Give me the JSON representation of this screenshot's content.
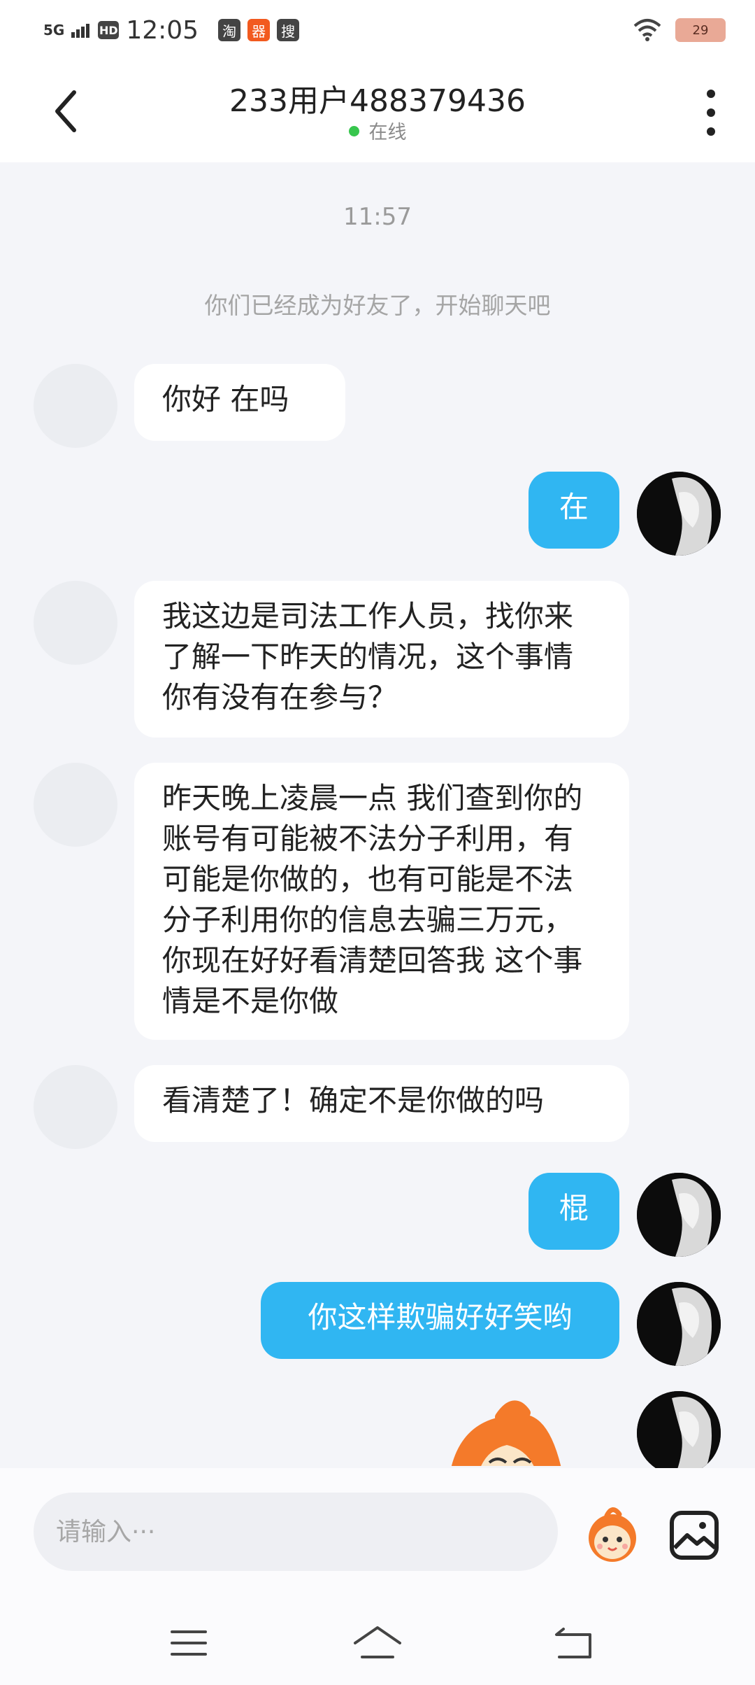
{
  "status_bar": {
    "signal": "5G",
    "hd": "HD",
    "time": "12:05",
    "apps": [
      {
        "label": "淘",
        "icon": "taobao-icon",
        "color": "#444444"
      },
      {
        "label": "器",
        "icon": "app-icon",
        "color": "#f25a1f"
      },
      {
        "label": "搜",
        "icon": "search-app-icon",
        "color": "#444444"
      }
    ],
    "battery": "29"
  },
  "header": {
    "title": "233用户488379436",
    "status": "在线",
    "status_color": "#37c64d"
  },
  "chat": {
    "timestamp": "11:57",
    "system_message": "你们已经成为好友了，开始聊天吧",
    "messages": [
      {
        "side": "left",
        "text": "你好  在吗"
      },
      {
        "side": "right",
        "text": "在"
      },
      {
        "side": "left",
        "text": "我这边是司法工作人员，找你来了解一下昨天的情况，这个事情你有没有在参与？"
      },
      {
        "side": "left",
        "text": "昨天晚上凌晨一点 我们查到你的账号有可能被不法分子利用，有可能是你做的，也有可能是不法分子利用你的信息去骗三万元，你现在好好看清楚回答我 这个事情是不是你做"
      },
      {
        "side": "left",
        "text": "看清楚了！确定不是你做的吗"
      },
      {
        "side": "right",
        "text": "棍"
      },
      {
        "side": "right",
        "text": "你这样欺骗好好笑哟"
      },
      {
        "side": "right",
        "type": "sticker",
        "icon": "cartoon-sticker"
      }
    ]
  },
  "input": {
    "placeholder": "请输入···"
  },
  "colors": {
    "bubble_right": "#30b6f2",
    "bubble_left": "#ffffff",
    "background": "#f4f5f9"
  }
}
